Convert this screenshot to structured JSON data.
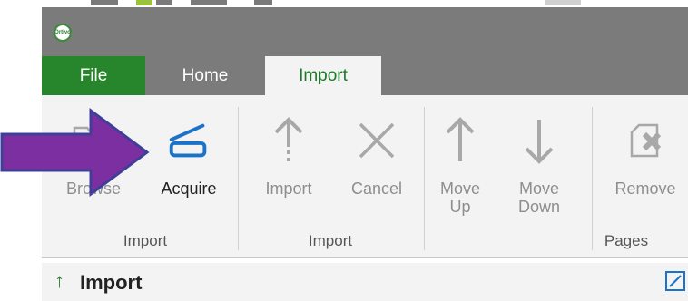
{
  "window": {
    "logo_text": "Ortivo"
  },
  "tabs": [
    {
      "label": "File"
    },
    {
      "label": "Home"
    },
    {
      "label": "Import"
    }
  ],
  "ribbon": {
    "buttons": [
      {
        "label": "Browse",
        "icon": "folder-icon",
        "enabled": false
      },
      {
        "label": "Acquire",
        "icon": "scanner-icon",
        "enabled": true
      },
      {
        "label": "Import",
        "icon": "arrow-up-dashed-icon",
        "enabled": false
      },
      {
        "label": "Cancel",
        "icon": "close-icon",
        "enabled": false
      },
      {
        "label": "Move\nUp",
        "icon": "arrow-up-icon",
        "enabled": false
      },
      {
        "label": "Move\nDown",
        "icon": "arrow-down-icon",
        "enabled": false
      },
      {
        "label": "Remove",
        "icon": "remove-page-icon",
        "enabled": false
      }
    ],
    "groups": [
      {
        "label": "Import"
      },
      {
        "label": "Import"
      },
      {
        "label": "Pages"
      }
    ]
  },
  "pane": {
    "title": "Import",
    "icon": "arrow-up-icon"
  },
  "colors": {
    "accent_green": "#27862b",
    "titlebar": "#7b7b7b",
    "acquire_blue": "#1a73c9",
    "callout_purple": "#7b2fa0"
  }
}
